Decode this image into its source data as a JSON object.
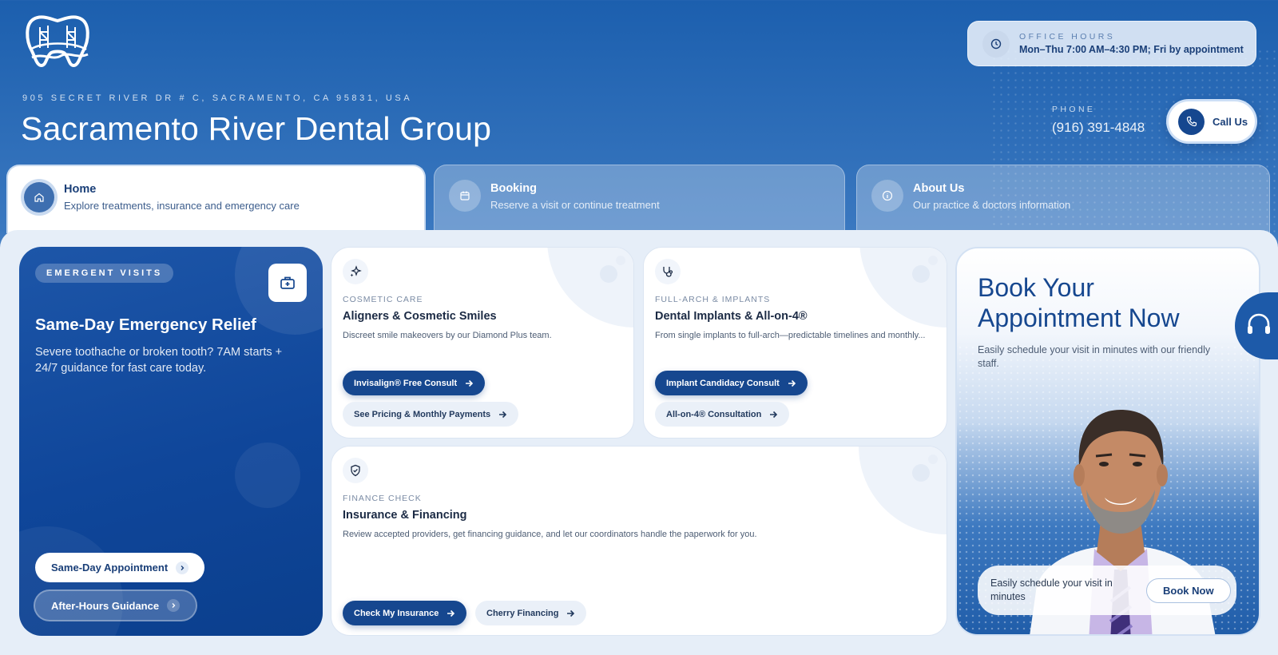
{
  "header": {
    "address": "905 SECRET RIVER DR # C, SACRAMENTO, CA 95831, USA",
    "title": "Sacramento River Dental Group",
    "hours_label": "OFFICE HOURS",
    "hours_value": "Mon–Thu 7:00 AM–4:30 PM; Fri by appointment",
    "phone_label": "PHONE",
    "phone_number": "(916) 391-4848",
    "call_label": "Call Us"
  },
  "tabs": [
    {
      "label": "Home",
      "subtitle": "Explore treatments, insurance and emergency care",
      "icon": "home-icon"
    },
    {
      "label": "Booking",
      "subtitle": "Reserve a visit or continue treatment",
      "icon": "calendar-icon"
    },
    {
      "label": "About Us",
      "subtitle": "Our practice & doctors information",
      "icon": "info-icon"
    }
  ],
  "emergency": {
    "badge": "EMERGENT VISITS",
    "title": "Same-Day Emergency Relief",
    "description": "Severe toothache or broken tooth? 7AM starts + 24/7 guidance for fast care today.",
    "primary_button": "Same-Day Appointment",
    "secondary_button": "After-Hours Guidance",
    "icon": "first-aid-kit-icon"
  },
  "services": [
    {
      "category": "COSMETIC CARE",
      "title": "Aligners & Cosmetic Smiles",
      "description": "Discreet smile makeovers by our Diamond Plus team.",
      "buttons": [
        "Invisalign® Free Consult",
        "See Pricing & Monthly Payments"
      ],
      "icon": "sparkles-icon"
    },
    {
      "category": "FULL-ARCH & IMPLANTS",
      "title": "Dental Implants & All-on-4®",
      "description": "From single implants to full-arch—predictable timelines and monthly...",
      "buttons": [
        "Implant Candidacy Consult",
        "All-on-4® Consultation"
      ],
      "icon": "stethoscope-icon"
    },
    {
      "category": "FINANCE CHECK",
      "title": "Insurance & Financing",
      "description": "Review accepted providers, get financing guidance, and let our coordinators handle the paperwork for you.",
      "buttons": [
        "Check My Insurance",
        "Cherry Financing"
      ],
      "icon": "shield-check-icon"
    }
  ],
  "booking": {
    "title_line1": "Book Your",
    "title_line2": "Appointment Now",
    "description": "Easily schedule your visit in minutes with our friendly staff.",
    "banner_text": "Easily schedule your visit in minutes",
    "banner_button": "Book Now"
  },
  "colors": {
    "primary": "#16478f",
    "header_gradient_top": "#1c5fae",
    "panel_bg": "#e6eef8"
  }
}
